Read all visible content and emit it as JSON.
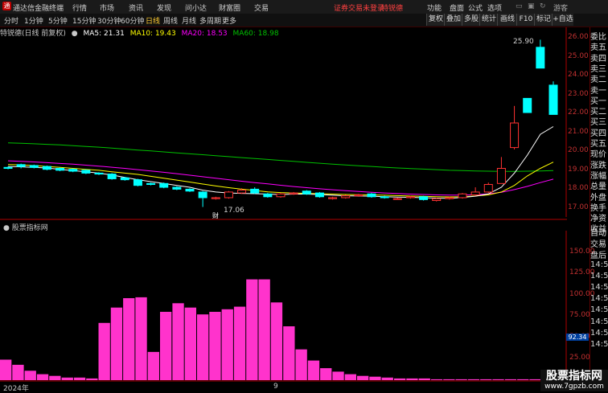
{
  "menubar": {
    "app_title": "通达信金融终端",
    "menus": [
      "行情",
      "市场",
      "资讯",
      "发现",
      "问小达",
      "财富圈",
      "交易"
    ],
    "login_status": "证券交易未登录",
    "stock_name": "特锐德",
    "right_menus": [
      "功能",
      "盘面",
      "公式",
      "选项"
    ],
    "guest": "游客"
  },
  "toolbar": {
    "periods": [
      "分时",
      "1分钟",
      "5分钟",
      "15分钟",
      "30分钟",
      "60分钟",
      "日线",
      "周线",
      "月线",
      "多周期",
      "更多"
    ],
    "buttons": [
      "复权",
      "叠加",
      "多股",
      "统计",
      "画线",
      "F10",
      "标记",
      "+自选"
    ]
  },
  "ma_line": {
    "title": "特锐德(日线 前复权)",
    "ma5": "MA5: 21.31",
    "ma10": "MA10: 19.43",
    "ma20": "MA20: 18.53",
    "ma60": "MA60: 18.98"
  },
  "price_axis": [
    "26.00",
    "25.00",
    "24.00",
    "23.00",
    "22.00",
    "21.00",
    "20.00",
    "19.00",
    "18.00",
    "17.00"
  ],
  "high_label": "25.90",
  "low_label": "17.06",
  "cai_label": "财",
  "sub_title": "股票指标网",
  "sub_axis": [
    "150.00",
    "125.00",
    "100.00",
    "75.00",
    "50.00",
    "25.00"
  ],
  "sub_value": "92.34",
  "date_axis": [
    "2024年",
    "9"
  ],
  "sidebar_labels": [
    "委比",
    "卖五",
    "卖四",
    "卖三",
    "卖二",
    "卖一",
    "买一",
    "买二",
    "买三",
    "买四",
    "买五",
    "现价",
    "涨跌",
    "涨幅",
    "总量",
    "外盘",
    "换手",
    "净资",
    "收益"
  ],
  "sidebar_bottom": [
    "自动",
    "交易",
    "盘后",
    "14:5",
    "14:5",
    "14:5",
    "14:5",
    "14:5",
    "14:5",
    "14:5",
    "14:5"
  ],
  "watermark": {
    "title": "股票指标网",
    "url": "www.7gpzb.com"
  },
  "colors": {
    "up": "#ff3232",
    "down": "#00ffff",
    "ma5": "#ffffff",
    "ma10": "#ffff00",
    "ma20": "#ff00ff",
    "ma60": "#00c000",
    "bar": "#ff33cc"
  },
  "chart_data": {
    "type": "candlestick",
    "candles": [
      [
        19.15,
        19.1,
        19.2,
        19.05
      ],
      [
        19.3,
        19.2,
        19.35,
        19.1
      ],
      [
        19.25,
        19.15,
        19.3,
        19.1
      ],
      [
        19.2,
        19.05,
        19.25,
        19.0
      ],
      [
        19.1,
        19.0,
        19.15,
        18.95
      ],
      [
        19.05,
        18.95,
        19.1,
        18.9
      ],
      [
        19.0,
        18.85,
        19.05,
        18.8
      ],
      [
        18.85,
        18.8,
        18.9,
        18.75
      ],
      [
        18.8,
        18.55,
        18.85,
        18.5
      ],
      [
        18.6,
        18.5,
        18.65,
        18.45
      ],
      [
        18.5,
        18.2,
        18.55,
        18.15
      ],
      [
        18.3,
        18.25,
        18.35,
        18.2
      ],
      [
        18.3,
        18.1,
        18.35,
        18.05
      ],
      [
        18.1,
        18.0,
        18.15,
        17.95
      ],
      [
        18.0,
        17.9,
        18.05,
        17.85
      ],
      [
        17.85,
        17.55,
        17.9,
        17.06
      ],
      [
        17.5,
        17.55,
        17.6,
        17.45
      ],
      [
        17.55,
        17.85,
        17.9,
        17.5
      ],
      [
        17.8,
        17.95,
        18.05,
        17.75
      ],
      [
        18.0,
        17.8,
        18.1,
        17.75
      ],
      [
        17.75,
        17.6,
        17.8,
        17.55
      ],
      [
        17.6,
        17.75,
        17.8,
        17.55
      ],
      [
        17.75,
        17.8,
        17.85,
        17.7
      ],
      [
        17.9,
        17.75,
        17.95,
        17.7
      ],
      [
        17.8,
        17.6,
        17.85,
        17.55
      ],
      [
        17.5,
        17.55,
        17.6,
        17.45
      ],
      [
        17.55,
        17.65,
        17.7,
        17.5
      ],
      [
        17.65,
        17.7,
        17.75,
        17.6
      ],
      [
        17.75,
        17.6,
        17.8,
        17.55
      ],
      [
        17.6,
        17.55,
        17.65,
        17.5
      ],
      [
        17.5,
        17.5,
        17.55,
        17.45
      ],
      [
        17.55,
        17.6,
        17.65,
        17.5
      ],
      [
        17.6,
        17.45,
        17.65,
        17.4
      ],
      [
        17.4,
        17.5,
        17.55,
        17.35
      ],
      [
        17.5,
        17.55,
        17.6,
        17.45
      ],
      [
        17.55,
        17.75,
        17.8,
        17.5
      ],
      [
        17.7,
        17.85,
        18.1,
        17.65
      ],
      [
        17.85,
        18.25,
        18.35,
        17.8
      ],
      [
        18.3,
        19.1,
        19.7,
        18.3
      ],
      [
        20.2,
        21.5,
        22.4,
        20.1
      ],
      [
        22.8,
        22.05,
        22.8,
        22.05
      ],
      [
        25.5,
        24.4,
        25.9,
        24.4
      ],
      [
        23.5,
        21.95,
        23.7,
        21.95
      ]
    ],
    "ma5": [
      19.2,
      19.18,
      19.15,
      19.12,
      19.05,
      18.98,
      18.92,
      18.85,
      18.75,
      18.62,
      18.5,
      18.4,
      18.3,
      18.2,
      18.1,
      17.95,
      17.85,
      17.8,
      17.78,
      17.76,
      17.74,
      17.72,
      17.74,
      17.74,
      17.72,
      17.68,
      17.65,
      17.64,
      17.63,
      17.6,
      17.58,
      17.57,
      17.55,
      17.53,
      17.52,
      17.56,
      17.63,
      17.75,
      18.1,
      18.85,
      19.8,
      20.9,
      21.31
    ],
    "ma10": [
      19.3,
      19.28,
      19.25,
      19.2,
      19.15,
      19.1,
      19.05,
      19.0,
      18.92,
      18.85,
      18.78,
      18.68,
      18.58,
      18.48,
      18.38,
      18.27,
      18.17,
      18.08,
      18.0,
      17.93,
      17.86,
      17.82,
      17.8,
      17.78,
      17.76,
      17.74,
      17.72,
      17.71,
      17.7,
      17.68,
      17.66,
      17.64,
      17.62,
      17.6,
      17.59,
      17.6,
      17.64,
      17.7,
      17.85,
      18.2,
      18.7,
      19.1,
      19.43
    ],
    "ma20": [
      19.5,
      19.47,
      19.44,
      19.4,
      19.36,
      19.32,
      19.27,
      19.22,
      19.16,
      19.1,
      19.03,
      18.96,
      18.89,
      18.82,
      18.74,
      18.66,
      18.58,
      18.5,
      18.42,
      18.35,
      18.28,
      18.21,
      18.14,
      18.08,
      18.02,
      17.97,
      17.92,
      17.88,
      17.84,
      17.8,
      17.77,
      17.74,
      17.72,
      17.7,
      17.69,
      17.69,
      17.71,
      17.75,
      17.84,
      17.98,
      18.15,
      18.35,
      18.53
    ],
    "ma60": [
      20.45,
      20.43,
      20.4,
      20.37,
      20.34,
      20.3,
      20.26,
      20.22,
      20.17,
      20.12,
      20.07,
      20.02,
      19.97,
      19.92,
      19.87,
      19.82,
      19.77,
      19.72,
      19.67,
      19.62,
      19.57,
      19.52,
      19.47,
      19.42,
      19.37,
      19.32,
      19.28,
      19.24,
      19.2,
      19.16,
      19.12,
      19.09,
      19.06,
      19.03,
      19.0,
      18.98,
      18.96,
      18.95,
      18.94,
      18.94,
      18.95,
      18.96,
      18.98
    ],
    "indicator_bars": [
      24,
      18,
      11,
      7,
      5,
      3,
      3,
      2,
      67,
      85,
      96,
      97,
      33,
      80,
      90,
      85,
      77,
      80,
      83,
      86,
      118,
      118,
      91,
      63,
      36,
      23,
      14,
      10,
      7,
      5,
      4,
      3,
      2,
      2,
      2,
      1,
      1,
      1,
      1,
      1,
      1,
      1,
      1,
      1,
      1
    ],
    "indicator_ylim": [
      0,
      175
    ],
    "price_ylim": [
      16.7,
      26.3
    ]
  }
}
